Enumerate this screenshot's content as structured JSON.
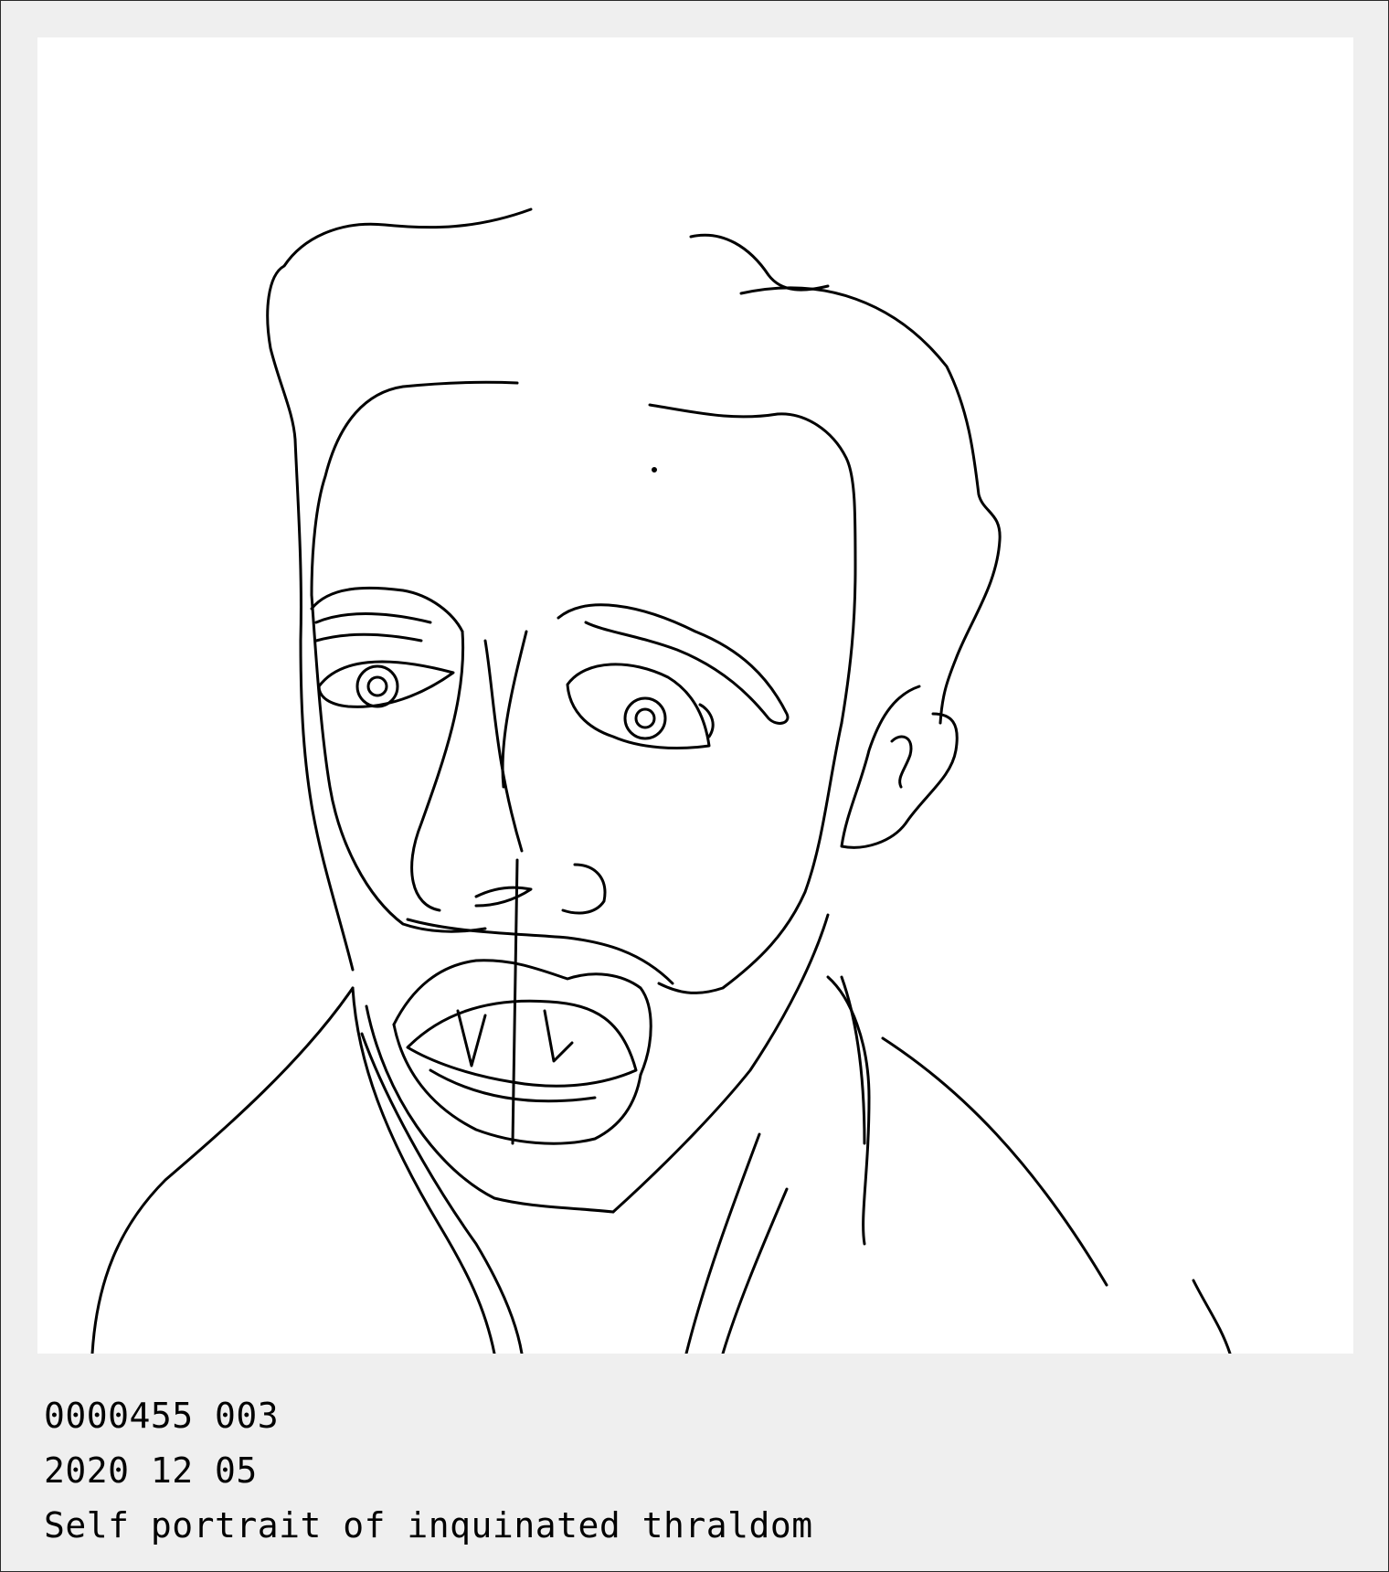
{
  "card": {
    "background": "#efefef",
    "border_color": "#2a2a2a"
  },
  "artwork": {
    "icon": "line-drawing-self-portrait",
    "stroke_color": "#000000",
    "paper_color": "#ffffff"
  },
  "caption": {
    "catalog_number": "0000455 003",
    "date": "2020 12 05",
    "title": "Self portrait of inquinated thraldom"
  }
}
